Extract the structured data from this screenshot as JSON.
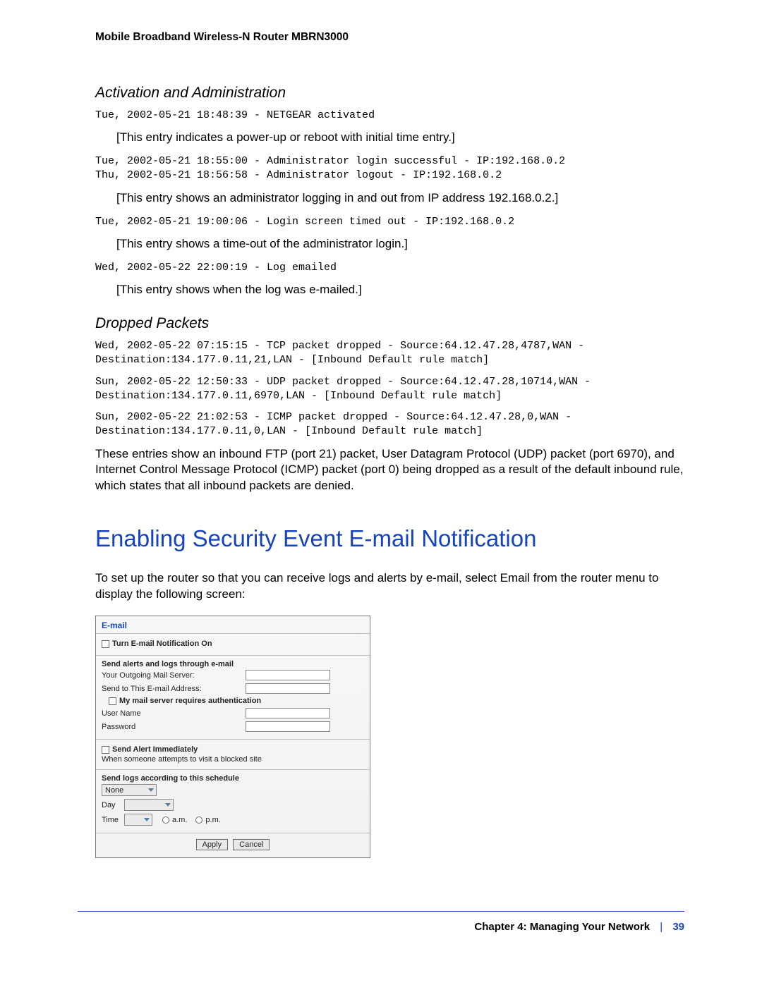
{
  "header": "Mobile Broadband Wireless-N Router MBRN3000",
  "sec1": {
    "title": "Activation and Administration",
    "log1": "Tue, 2002-05-21 18:48:39 - NETGEAR activated",
    "c1": "[This entry indicates a power-up or reboot with initial time entry.]",
    "log2": "Tue, 2002-05-21 18:55:00 - Administrator login successful - IP:192.168.0.2\nThu, 2002-05-21 18:56:58 - Administrator logout - IP:192.168.0.2",
    "c2": "[This entry shows an administrator logging in and out from IP address 192.168.0.2.]",
    "log3": "Tue, 2002-05-21 19:00:06 - Login screen timed out - IP:192.168.0.2",
    "c3": "[This entry shows a time-out of the administrator login.]",
    "log4": "Wed, 2002-05-22 22:00:19 - Log emailed",
    "c4": "[This entry shows when the log was e-mailed.]"
  },
  "sec2": {
    "title": "Dropped Packets",
    "log1": "Wed, 2002-05-22 07:15:15 - TCP packet dropped - Source:64.12.47.28,4787,WAN - Destination:134.177.0.11,21,LAN - [Inbound Default rule match]",
    "log2": "Sun, 2002-05-22 12:50:33 - UDP packet dropped - Source:64.12.47.28,10714,WAN - Destination:134.177.0.11,6970,LAN - [Inbound Default rule match]",
    "log3": "Sun, 2002-05-22 21:02:53 - ICMP packet dropped - Source:64.12.47.28,0,WAN - Destination:134.177.0.11,0,LAN - [Inbound Default rule match]",
    "body": "These entries show an inbound FTP (port 21) packet, User Datagram Protocol (UDP) packet (port 6970), and Internet Control Message Protocol (ICMP) packet (port 0) being dropped as a result of the default inbound rule, which states that all inbound packets are denied."
  },
  "h1": "Enabling Security Event E-mail Notification",
  "intro": "To set up the router so that you can receive logs and alerts by e-mail, select Email from the router menu to display the following screen:",
  "email_ui": {
    "title": "E-mail",
    "cb_on": "Turn E-mail Notification On",
    "send_hdr": "Send alerts and logs through e-mail",
    "server_lbl": "Your Outgoing Mail Server:",
    "addr_lbl": "Send to This E-mail Address:",
    "auth_cb": "My mail server requires authentication",
    "user_lbl": "User Name",
    "pass_lbl": "Password",
    "alert_cb": "Send Alert Immediately",
    "alert_desc": "When someone attempts to visit a blocked site",
    "sched_hdr": "Send logs according to this schedule",
    "sched_sel": "None",
    "day_lbl": "Day",
    "time_lbl": "Time",
    "am": "a.m.",
    "pm": "p.m.",
    "apply": "Apply",
    "cancel": "Cancel"
  },
  "footer": {
    "chapter": "Chapter 4:  Managing Your Network",
    "page": "39"
  }
}
